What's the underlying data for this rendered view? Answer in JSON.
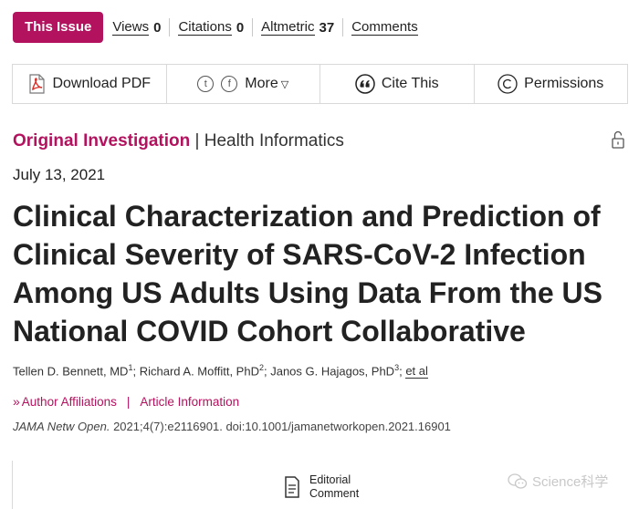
{
  "top": {
    "issue_label": "This Issue",
    "metrics": [
      {
        "label": "Views",
        "value": "0"
      },
      {
        "label": "Citations",
        "value": "0"
      },
      {
        "label": "Altmetric",
        "value": "37"
      },
      {
        "label": "Comments",
        "value": ""
      }
    ]
  },
  "toolbar": {
    "download": "Download PDF",
    "twitter_icon": "t",
    "facebook_icon": "f",
    "more": "More",
    "more_caret": "▽",
    "cite": "Cite This",
    "permissions": "Permissions"
  },
  "article": {
    "category": "Original Investigation",
    "subcategory": "Health Informatics",
    "category_sep": "|",
    "date": "July 13, 2021",
    "title": "Clinical Characterization and Prediction of Clinical Severity of SARS-CoV-2 Infection Among US Adults Using Data From the US National COVID Cohort Collaborative",
    "authors": [
      {
        "name": "Tellen D. Bennett, MD",
        "sup": "1"
      },
      {
        "name": "Richard A. Moffitt, PhD",
        "sup": "2"
      },
      {
        "name": "Janos G. Hajagos, PhD",
        "sup": "3"
      }
    ],
    "et_al": "et al",
    "affiliations_link": "Author Affiliations",
    "article_info_link": "Article Information",
    "journal": "JAMA Netw Open.",
    "citation_rest": "2021;4(7):e2116901. doi:10.1001/jamanetworkopen.2021.16901"
  },
  "bottom": {
    "editorial_line1": "Editorial",
    "editorial_line2": "Comment",
    "watermark": "Science科学"
  },
  "colors": {
    "brand": "#b3125e",
    "text": "#222222",
    "border": "#d9d9d9"
  }
}
